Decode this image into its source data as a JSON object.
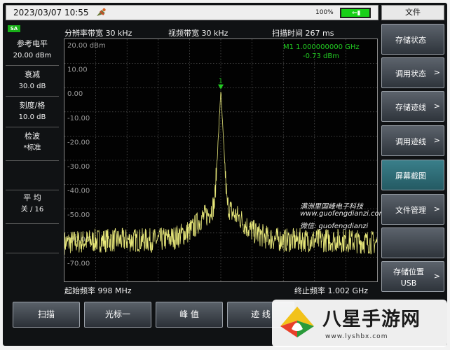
{
  "topbar": {
    "datetime": "2023/03/07 10:55",
    "battery_pct": "100%",
    "battery_level": 1.0
  },
  "mode_badge": "SA",
  "left_panel": [
    {
      "label": "参考电平",
      "value": "20.00 dBm"
    },
    {
      "label": "衰减",
      "value": "30.0 dB"
    },
    {
      "label": "刻度/格",
      "value": "10.0 dB"
    },
    {
      "label": "检波",
      "value": "*标准"
    },
    {
      "label": "平 均",
      "value": "关 / 16"
    }
  ],
  "graph_header": {
    "rbw": "分辨率带宽  30 kHz",
    "vbw": "视频带宽  30 kHz",
    "sweep": "扫描时间  267 ms"
  },
  "graph_footer": {
    "start": "起始频率  998 MHz",
    "stop": "终止频率  1.002 GHz"
  },
  "marker": {
    "label": "M1",
    "freq": "1.000000000 GHz",
    "level": "-0.73 dBm",
    "number": "1"
  },
  "overlay": {
    "line1": "满洲里国峰电子科技",
    "line2": "www.guofengdianzi.com",
    "line3": "微信:  guofengdianzi"
  },
  "right_menu": {
    "title": "文件",
    "items": [
      {
        "label": "存储状态",
        "has_arrow": false
      },
      {
        "label": "调用状态",
        "has_arrow": true
      },
      {
        "label": "存储迹线",
        "has_arrow": true
      },
      {
        "label": "调用迹线",
        "has_arrow": true
      },
      {
        "label": "屏幕截图",
        "has_arrow": false,
        "active": true
      },
      {
        "label": "文件管理",
        "has_arrow": true
      },
      {
        "label": "",
        "has_arrow": false
      },
      {
        "label": "存储位置",
        "sub": "USB",
        "has_arrow": true
      }
    ]
  },
  "bottom_keys": [
    "扫描",
    "光标一",
    "峰 值",
    "迹 线"
  ],
  "watermark": {
    "title": "八星手游网",
    "url": "www.lyshbx.com"
  },
  "colors": {
    "trace": "#e8e87a",
    "marker": "#22cc22",
    "grid": "#6a6a6a",
    "active_key": "#2f6f78"
  },
  "chart_data": {
    "type": "line",
    "x_unit": "MHz",
    "y_unit": "dBm",
    "xlim": [
      998,
      1002
    ],
    "ylim": [
      -80,
      20
    ],
    "y_ticks": [
      "20.00 dBm",
      "10.00",
      "0.00",
      "-10.00",
      "-20.00",
      "-30.00",
      "-40.00",
      "-50.00",
      "-60.00",
      "-70.00"
    ],
    "grid": true,
    "series": [
      {
        "x": [
          998.0,
          998.5,
          999.0,
          999.2,
          999.4,
          999.55,
          999.65,
          999.75,
          999.85,
          999.92,
          999.97,
          1000.0,
          1000.03,
          1000.08,
          1000.15,
          1000.25,
          1000.35,
          1000.45,
          1000.6,
          1000.8,
          1001.0,
          1001.5,
          1002.0
        ],
        "y": [
          -64,
          -63,
          -63,
          -63,
          -62,
          -60,
          -58,
          -54,
          -52,
          -48,
          -20,
          -1,
          -20,
          -48,
          -52,
          -54,
          -58,
          -60,
          -62,
          -63,
          -63,
          -63,
          -64
        ]
      }
    ]
  }
}
